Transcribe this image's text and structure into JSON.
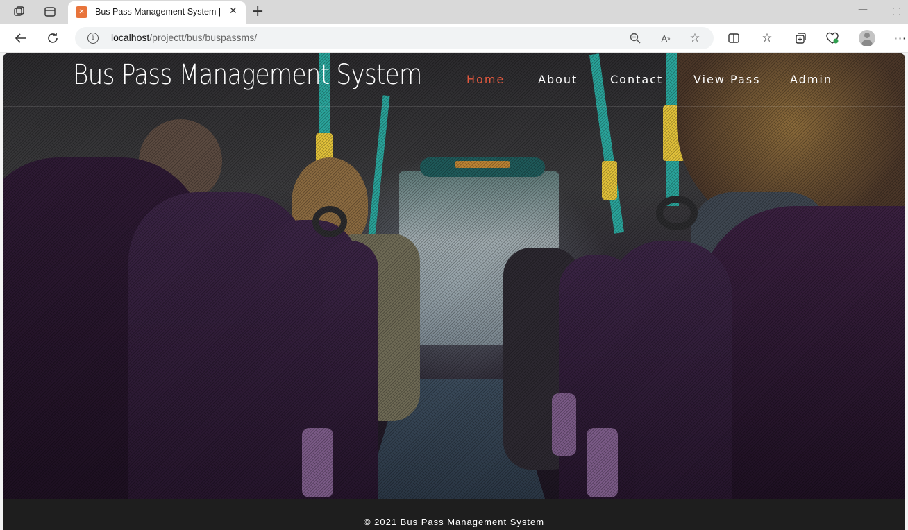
{
  "browser": {
    "tab_title": "Bus Pass Management System || Home",
    "tab_favicon_icon": "xampp-icon",
    "url_host": "localhost",
    "url_path": "/projectt/bus/buspassms/"
  },
  "site": {
    "title": "Bus Pass Management System",
    "nav": [
      {
        "label": "Home",
        "active": true
      },
      {
        "label": "About",
        "active": false
      },
      {
        "label": "Contact",
        "active": false
      },
      {
        "label": "View Pass",
        "active": false
      },
      {
        "label": "Admin",
        "active": false
      }
    ],
    "accent_color": "#e2583e",
    "hero_image": "bus-interior-seats-photo",
    "footer": "© 2021 Bus Pass Management System"
  }
}
